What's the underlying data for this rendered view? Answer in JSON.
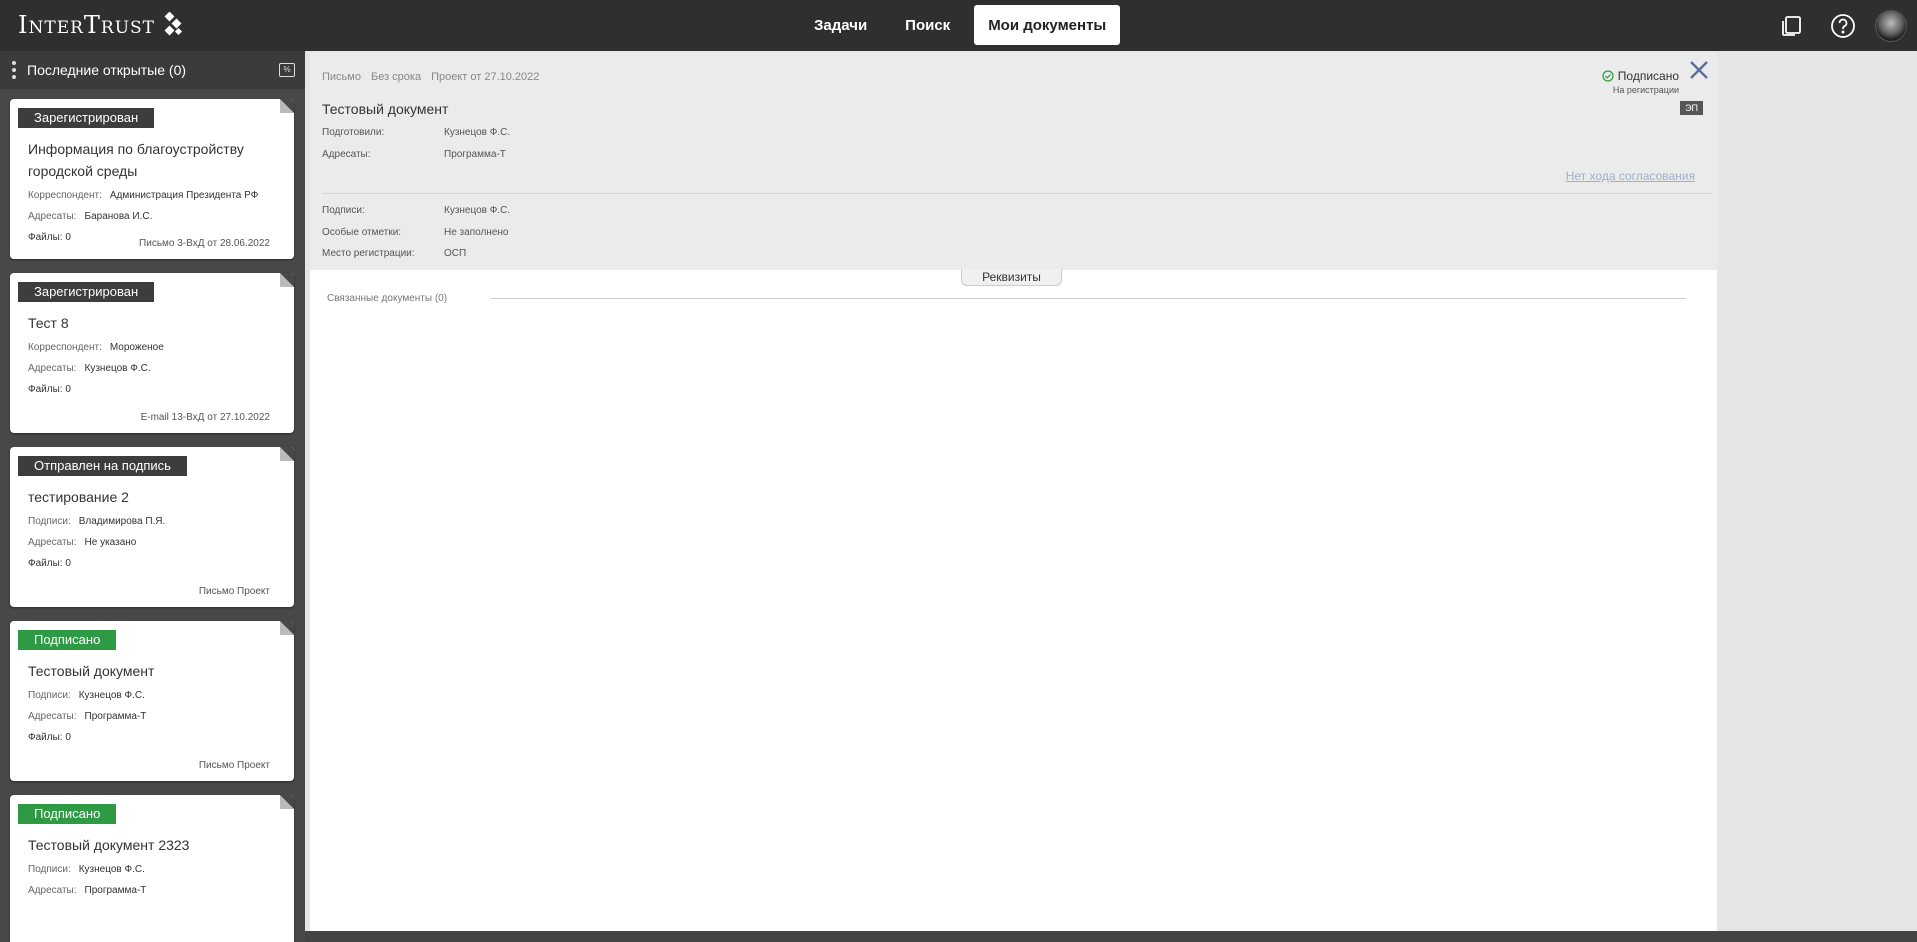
{
  "header": {
    "logo_text": "InterTrust",
    "tabs": [
      {
        "label": "Задачи",
        "active": false
      },
      {
        "label": "Поиск",
        "active": false
      },
      {
        "label": "Мои документы",
        "active": true
      }
    ],
    "icons": [
      "copy-icon",
      "help-icon",
      "avatar"
    ]
  },
  "sidebar": {
    "title": "Последние открытые (0)",
    "cards": [
      {
        "status": "Зарегистрирован",
        "status_color": "#3d3d3d",
        "title": "Информация по благоустройству городской среды",
        "rows": [
          {
            "label": "Корреспондент:",
            "value": "Администрация Президента РФ"
          },
          {
            "label": "Адресаты:",
            "value": "Баранова И.С."
          },
          {
            "label": "Файлы: 0",
            "value": ""
          }
        ],
        "footer": "Письмо 3-ВхД от 28.06.2022"
      },
      {
        "status": "Зарегистрирован",
        "status_color": "#3d3d3d",
        "title": "Тест 8",
        "rows": [
          {
            "label": "Корреспондент:",
            "value": "Мороженое"
          },
          {
            "label": "Адресаты:",
            "value": "Кузнецов Ф.С."
          },
          {
            "label": "Файлы: 0",
            "value": ""
          }
        ],
        "footer": "E-mail 13-ВхД от 27.10.2022"
      },
      {
        "status": "Отправлен на подпись",
        "status_color": "#3d3d3d",
        "title": "тестирование 2",
        "rows": [
          {
            "label": "Подписи:",
            "value": "Владимирова П.Я."
          },
          {
            "label": "Адресаты:",
            "value": "Не указано"
          },
          {
            "label": "Файлы: 0",
            "value": ""
          }
        ],
        "footer": "Письмо Проект"
      },
      {
        "status": "Подписано",
        "status_color": "#2e9b44",
        "title": "Тестовый документ",
        "rows": [
          {
            "label": "Подписи:",
            "value": "Кузнецов Ф.С."
          },
          {
            "label": "Адресаты:",
            "value": "Программа-Т"
          },
          {
            "label": "Файлы: 0",
            "value": ""
          }
        ],
        "footer": "Письмо Проект"
      },
      {
        "status": "Подписано",
        "status_color": "#2e9b44",
        "title": "Тестовый документ 2323",
        "rows": [
          {
            "label": "Подписи:",
            "value": "Кузнецов Ф.С."
          },
          {
            "label": "Адресаты:",
            "value": "Программа-Т"
          },
          {
            "label": "",
            "value": ""
          }
        ],
        "footer": ""
      }
    ]
  },
  "document": {
    "meta": [
      "Письмо",
      "Без срока",
      "Проект от 27.10.2022"
    ],
    "title": "Тестовый документ",
    "prepared_label": "Подготовили:",
    "prepared_value": "Кузнецов Ф.С.",
    "addressees_label": "Адресаты:",
    "addressees_value": "Программа-Т",
    "signatures_label": "Подписи:",
    "signatures_value": "Кузнецов Ф.С.",
    "notes_label": "Особые отметки:",
    "notes_value": "Не заполнено",
    "reg_place_label": "Место регистрации:",
    "reg_place_value": "ОСП",
    "status_main": "Подписано",
    "status_sub": "На регистрации",
    "ep_badge": "ЭП",
    "no_approval": "Нет хода согласования",
    "requisites_button": "Реквизиты",
    "linked_docs": "Связанные документы (0)"
  }
}
